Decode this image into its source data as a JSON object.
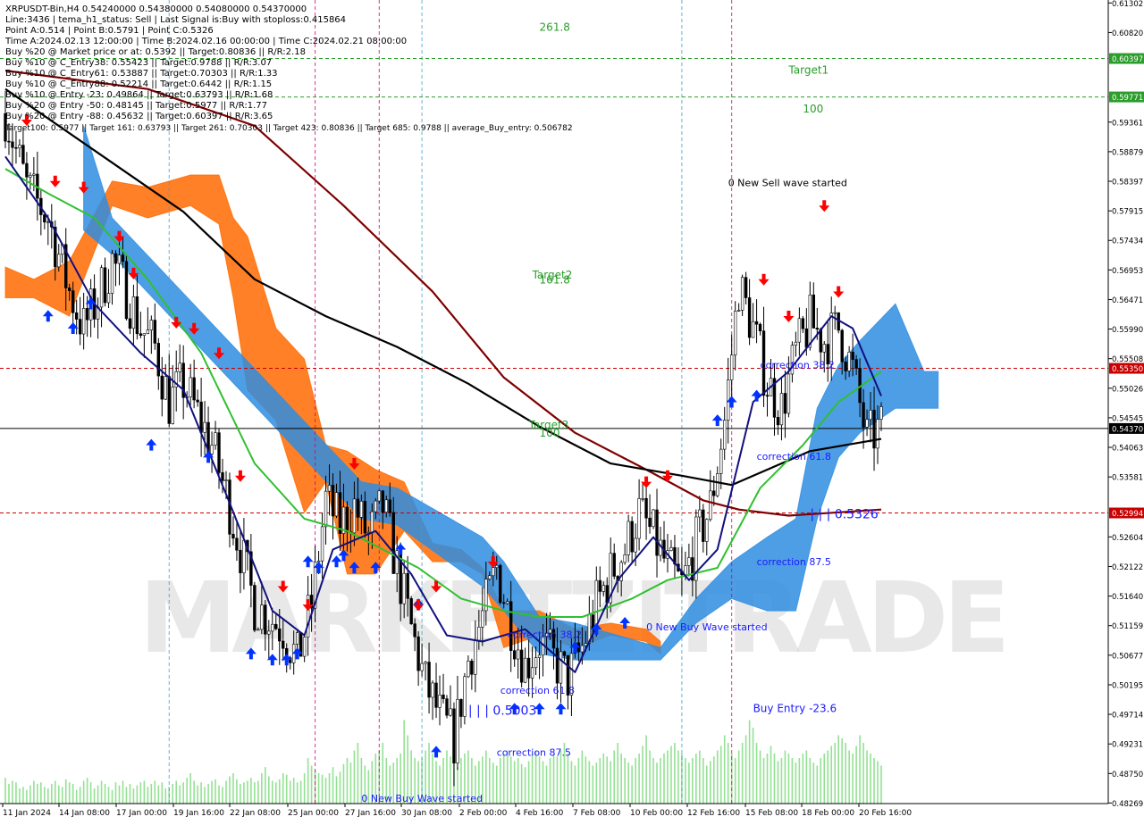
{
  "header": {
    "title": "XRPUSDT-Bin,H4  0.54240000 0.54380000 0.54080000 0.54370000",
    "lines": [
      "Line:3436 | tema_h1_status: Sell | Last Signal is:Buy with stoploss:0.415864",
      "Point A:0.514 | Point B:0.5791 | Point C:0.5326",
      "Time A:2024.02.13 12:00:00 | Time B:2024.02.16 00:00:00 | Time C:2024.02.21 08:00:00",
      "Buy %20 @ Market price or at: 0.5392 || Target:0.80836 || R/R:2.18",
      "Buy %10 @ C_Entry38: 0.55423 || Target:0.9788 || R/R:3.07",
      "Buy %10 @ C_Entry61: 0.53887 || Target:0.70303 || R/R:1.33",
      "Buy %10 @ C_Entry88: 0.52214 || Target:0.6442 || R/R:1.15",
      "Buy %10 @ Entry -23: 0.49864 || Target:0.63793 || R/R:1.68",
      "Buy %20 @ Entry -50: 0.48145 || Target:0.5977 || R/R:1.77",
      "Buy %20 @ Entry -88: 0.45632 || Target:0.60397 || R/R:3.65",
      "Target100: 0.5977 || Target 161: 0.63793 || Target 261: 0.70303 || Target 423: 0.80836 || Target 685: 0.9788 || average_Buy_entry: 0.506782"
    ]
  },
  "watermark": "MARKETZITRADE",
  "colors": {
    "bull": "#00c800",
    "bear": "#c80000",
    "ema_fast": "#10107f",
    "ema_mid": "#30c030",
    "ema_slow": "#000000",
    "ema_long": "#7f0000",
    "cloud_orange": "#ff6a00",
    "cloud_blue": "#2f8de0",
    "buy_arrow": "#0033ff",
    "sell_arrow": "#ff0000",
    "green_text": "#2a9d2a",
    "blue_text": "#1a1aff"
  },
  "chart_data": {
    "type": "candlestick",
    "symbol": "XRPUSDT-Bin",
    "timeframe": "H4",
    "ylim": [
      0.4826,
      0.6135
    ],
    "yticks": [
      0.61302,
      0.6082,
      0.60397,
      0.59771,
      0.59361,
      0.58879,
      0.58397,
      0.57915,
      0.57434,
      0.56953,
      0.5647,
      0.5599,
      0.55508,
      0.5535,
      0.55026,
      0.54545,
      0.5437,
      0.54063,
      0.53581,
      0.52994,
      0.52604,
      0.52122,
      0.5164,
      0.51159,
      0.50677,
      0.50195,
      0.49714,
      0.49231,
      0.4875,
      0.48269
    ],
    "yticks_text": [
      "0.61302",
      "0.60820",
      "0.60397",
      "0.59771",
      "0.59361",
      "0.58879",
      "0.58397",
      "0.57915",
      "0.57434",
      "0.56953",
      "0.56471",
      "0.55990",
      "0.55508",
      "0.55350",
      "0.55026",
      "0.54545",
      "0.54370",
      "0.54063",
      "0.53581",
      "0.52994",
      "0.52604",
      "0.52122",
      "0.51640",
      "0.51159",
      "0.50677",
      "0.50195",
      "0.49714",
      "0.49231",
      "0.48750",
      "0.48269"
    ],
    "highlighted_levels": [
      {
        "value": 0.60397,
        "label": "0.60397",
        "color": "#2a9d2a",
        "style": "dash"
      },
      {
        "value": 0.59771,
        "label": "0.59771",
        "color": "#2a9d2a",
        "style": "dash"
      },
      {
        "value": 0.5535,
        "label": "0.55350",
        "color": "#c80000",
        "style": "dash"
      },
      {
        "value": 0.5437,
        "label": "0.54370",
        "color": "#000000",
        "style": "solid"
      },
      {
        "value": 0.52994,
        "label": "0.52994",
        "color": "#c80000",
        "style": "dash"
      }
    ],
    "xticks": [
      "11 Jan 2024",
      "14 Jan 08:00",
      "17 Jan 00:00",
      "19 Jan 16:00",
      "22 Jan 08:00",
      "25 Jan 00:00",
      "27 Jan 16:00",
      "30 Jan 08:00",
      "2 Feb 00:00",
      "4 Feb 16:00",
      "7 Feb 08:00",
      "10 Feb 00:00",
      "12 Feb 16:00",
      "15 Feb 08:00",
      "18 Feb 00:00",
      "20 Feb 16:00"
    ],
    "close_path": [
      [
        0,
        0.595
      ],
      [
        6,
        0.583
      ],
      [
        12,
        0.578
      ],
      [
        18,
        0.566
      ],
      [
        22,
        0.56
      ],
      [
        26,
        0.565
      ],
      [
        30,
        0.571
      ],
      [
        34,
        0.566
      ],
      [
        38,
        0.56
      ],
      [
        42,
        0.557
      ],
      [
        46,
        0.548
      ],
      [
        50,
        0.551
      ],
      [
        54,
        0.546
      ],
      [
        58,
        0.541
      ],
      [
        62,
        0.533
      ],
      [
        66,
        0.524
      ],
      [
        70,
        0.515
      ],
      [
        74,
        0.513
      ],
      [
        78,
        0.511
      ],
      [
        82,
        0.506
      ],
      [
        86,
        0.515
      ],
      [
        90,
        0.532
      ],
      [
        94,
        0.528
      ],
      [
        98,
        0.531
      ],
      [
        102,
        0.526
      ],
      [
        106,
        0.531
      ],
      [
        110,
        0.521
      ],
      [
        114,
        0.511
      ],
      [
        118,
        0.502
      ],
      [
        122,
        0.497
      ],
      [
        126,
        0.493
      ],
      [
        130,
        0.506
      ],
      [
        134,
        0.513
      ],
      [
        138,
        0.521
      ],
      [
        142,
        0.512
      ],
      [
        146,
        0.505
      ],
      [
        150,
        0.509
      ],
      [
        154,
        0.506
      ],
      [
        158,
        0.503
      ],
      [
        162,
        0.508
      ],
      [
        166,
        0.515
      ],
      [
        170,
        0.52
      ],
      [
        174,
        0.524
      ],
      [
        178,
        0.53
      ],
      [
        182,
        0.526
      ],
      [
        186,
        0.521
      ],
      [
        190,
        0.518
      ],
      [
        194,
        0.525
      ],
      [
        198,
        0.531
      ],
      [
        202,
        0.545
      ],
      [
        206,
        0.567
      ],
      [
        210,
        0.56
      ],
      [
        214,
        0.551
      ],
      [
        218,
        0.547
      ],
      [
        222,
        0.556
      ],
      [
        226,
        0.561
      ],
      [
        230,
        0.558
      ],
      [
        234,
        0.56
      ],
      [
        238,
        0.553
      ],
      [
        242,
        0.542
      ],
      [
        246,
        0.5437
      ]
    ],
    "total_bars": 247,
    "ema_fast": [
      [
        0,
        0.588
      ],
      [
        12,
        0.578
      ],
      [
        25,
        0.564
      ],
      [
        38,
        0.556
      ],
      [
        50,
        0.55
      ],
      [
        62,
        0.533
      ],
      [
        75,
        0.514
      ],
      [
        84,
        0.51
      ],
      [
        92,
        0.524
      ],
      [
        104,
        0.527
      ],
      [
        114,
        0.52
      ],
      [
        124,
        0.51
      ],
      [
        134,
        0.509
      ],
      [
        146,
        0.511
      ],
      [
        160,
        0.504
      ],
      [
        172,
        0.519
      ],
      [
        182,
        0.526
      ],
      [
        192,
        0.519
      ],
      [
        200,
        0.524
      ],
      [
        210,
        0.548
      ],
      [
        220,
        0.553
      ],
      [
        232,
        0.562
      ],
      [
        238,
        0.56
      ],
      [
        246,
        0.549
      ]
    ],
    "ema_mid": [
      [
        0,
        0.586
      ],
      [
        12,
        0.582
      ],
      [
        25,
        0.578
      ],
      [
        40,
        0.568
      ],
      [
        55,
        0.556
      ],
      [
        70,
        0.538
      ],
      [
        84,
        0.529
      ],
      [
        96,
        0.527
      ],
      [
        106,
        0.524
      ],
      [
        116,
        0.521
      ],
      [
        128,
        0.516
      ],
      [
        140,
        0.514
      ],
      [
        150,
        0.513
      ],
      [
        162,
        0.513
      ],
      [
        176,
        0.516
      ],
      [
        186,
        0.519
      ],
      [
        200,
        0.521
      ],
      [
        212,
        0.534
      ],
      [
        224,
        0.541
      ],
      [
        234,
        0.548
      ],
      [
        246,
        0.553
      ]
    ],
    "ema_slow": [
      [
        0,
        0.599
      ],
      [
        30,
        0.587
      ],
      [
        50,
        0.579
      ],
      [
        70,
        0.568
      ],
      [
        90,
        0.562
      ],
      [
        110,
        0.557
      ],
      [
        130,
        0.551
      ],
      [
        150,
        0.544
      ],
      [
        170,
        0.538
      ],
      [
        190,
        0.536
      ],
      [
        204,
        0.5345
      ],
      [
        214,
        0.537
      ],
      [
        226,
        0.54
      ],
      [
        246,
        0.542
      ]
    ],
    "ema_long": [
      [
        0,
        0.602
      ],
      [
        40,
        0.599
      ],
      [
        70,
        0.593
      ],
      [
        95,
        0.58
      ],
      [
        120,
        0.566
      ],
      [
        140,
        0.552
      ],
      [
        160,
        0.543
      ],
      [
        180,
        0.537
      ],
      [
        196,
        0.532
      ],
      [
        206,
        0.5305
      ],
      [
        220,
        0.5295
      ],
      [
        246,
        0.5305
      ]
    ],
    "cloud_orange": [
      [
        0,
        0.57,
        0.565
      ],
      [
        8,
        0.568,
        0.565
      ],
      [
        18,
        0.562,
        0.571
      ],
      [
        30,
        0.584,
        0.58
      ],
      [
        40,
        0.583,
        0.578
      ],
      [
        52,
        0.585,
        0.58
      ],
      [
        60,
        0.585,
        0.577
      ],
      [
        64,
        0.578,
        0.565
      ],
      [
        68,
        0.575,
        0.55
      ],
      [
        76,
        0.56,
        0.545
      ],
      [
        84,
        0.555,
        0.53
      ],
      [
        90,
        0.541,
        0.535
      ],
      [
        96,
        0.54,
        0.52
      ],
      [
        104,
        0.537,
        0.52
      ],
      [
        112,
        0.535,
        0.527
      ],
      [
        120,
        0.525,
        0.522
      ],
      [
        128,
        0.524,
        0.522
      ],
      [
        134,
        0.521,
        0.52
      ],
      [
        140,
        0.514,
        0.508
      ],
      [
        150,
        0.514,
        0.51
      ],
      [
        160,
        0.511,
        0.508
      ],
      [
        170,
        0.512,
        0.51
      ],
      [
        180,
        0.511,
        0.509
      ],
      [
        184,
        0.509,
        0.507
      ]
    ],
    "cloud_blue": [
      [
        22,
        0.593,
        0.576
      ],
      [
        30,
        0.578,
        0.572
      ],
      [
        100,
        0.535,
        0.529
      ],
      [
        110,
        0.534,
        0.528
      ],
      [
        134,
        0.526,
        0.518
      ],
      [
        140,
        0.522,
        0.514
      ],
      [
        150,
        0.513,
        0.507
      ],
      [
        160,
        0.512,
        0.506
      ],
      [
        184,
        0.508,
        0.506
      ],
      [
        194,
        0.516,
        0.512
      ],
      [
        204,
        0.522,
        0.516
      ],
      [
        214,
        0.526,
        0.514
      ],
      [
        222,
        0.529,
        0.514
      ],
      [
        228,
        0.547,
        0.529
      ],
      [
        234,
        0.554,
        0.539
      ],
      [
        240,
        0.558,
        0.543
      ],
      [
        250,
        0.564,
        0.547
      ],
      [
        258,
        0.553,
        0.547
      ],
      [
        262,
        0.553,
        0.547
      ]
    ],
    "fib_lines": [
      {
        "x": 87,
        "color": "#cc0077"
      },
      {
        "x": 105,
        "color": "#cc0077"
      },
      {
        "x": 204,
        "color": "#cc0077"
      },
      {
        "x": 46,
        "color": "#3aa0d0"
      },
      {
        "x": 117,
        "color": "#3aa0d0"
      },
      {
        "x": 190,
        "color": "#3aa0d0"
      }
    ],
    "annotations": [
      {
        "text": "261.8",
        "x": 150,
        "y": 0.6085,
        "color": "#2a9d2a",
        "size": 12
      },
      {
        "text": "Target1",
        "x": 220,
        "y": 0.6015,
        "color": "#2a9d2a",
        "size": 12
      },
      {
        "text": "100",
        "x": 224,
        "y": 0.5952,
        "color": "#2a9d2a",
        "size": 12
      },
      {
        "text": "Target2",
        "x": 148,
        "y": 0.5681,
        "color": "#2a9d2a",
        "size": 12
      },
      {
        "text": "161.8",
        "x": 150,
        "y": 0.5673,
        "color": "#2a9d2a",
        "size": 12
      },
      {
        "text": "Target3",
        "x": 147,
        "y": 0.5437,
        "color": "#2a9d2a",
        "size": 12
      },
      {
        "text": "100",
        "x": 150,
        "y": 0.5424,
        "color": "#2a9d2a",
        "size": 12
      },
      {
        "text": "0 New Sell wave started",
        "x": 203,
        "y": 0.5832,
        "color": "#000000",
        "size": 11
      },
      {
        "text": "correction 38.2",
        "x": 212,
        "y": 0.5535,
        "color": "#1a1aff",
        "size": 11
      },
      {
        "text": "correction 61.8",
        "x": 211,
        "y": 0.5386,
        "color": "#1a1aff",
        "size": 11
      },
      {
        "text": "| | | 0.5326",
        "x": 226,
        "y": 0.5291,
        "color": "#1a1aff",
        "size": 14
      },
      {
        "text": "correction 87.5",
        "x": 211,
        "y": 0.5214,
        "color": "#1a1aff",
        "size": 11
      },
      {
        "text": "0 New Buy Wave started",
        "x": 180,
        "y": 0.5108,
        "color": "#1a1aff",
        "size": 11
      },
      {
        "text": "Buy Entry -23.6",
        "x": 210,
        "y": 0.4975,
        "color": "#1a1aff",
        "size": 12
      },
      {
        "text": "correction 38.2",
        "x": 141,
        "y": 0.5096,
        "color": "#1a1aff",
        "size": 11
      },
      {
        "text": "correction 61.8",
        "x": 139,
        "y": 0.5005,
        "color": "#1a1aff",
        "size": 11
      },
      {
        "text": "| | | 0.5003",
        "x": 130,
        "y": 0.4971,
        "color": "#1a1aff",
        "size": 14
      },
      {
        "text": "correction 87.5",
        "x": 138,
        "y": 0.4904,
        "color": "#1a1aff",
        "size": 11
      },
      {
        "text": "0 New Buy Wave started",
        "x": 100,
        "y": 0.4829,
        "color": "#1a1aff",
        "size": 11
      }
    ],
    "buy_arrows": [
      [
        12,
        0.563
      ],
      [
        19,
        0.561
      ],
      [
        24,
        0.565
      ],
      [
        41,
        0.542
      ],
      [
        57,
        0.54
      ],
      [
        69,
        0.508
      ],
      [
        75,
        0.507
      ],
      [
        79,
        0.507
      ],
      [
        82,
        0.508
      ],
      [
        85,
        0.523
      ],
      [
        88,
        0.522
      ],
      [
        93,
        0.523
      ],
      [
        98,
        0.522
      ],
      [
        95,
        0.524
      ],
      [
        104,
        0.522
      ],
      [
        111,
        0.525
      ],
      [
        116,
        0.516
      ],
      [
        121,
        0.492
      ],
      [
        143,
        0.499
      ],
      [
        150,
        0.499
      ],
      [
        156,
        0.499
      ],
      [
        160,
        0.509
      ],
      [
        166,
        0.512
      ],
      [
        174,
        0.513
      ],
      [
        200,
        0.546
      ],
      [
        204,
        0.549
      ],
      [
        211,
        0.55
      ]
    ],
    "sell_arrows": [
      [
        6,
        0.593
      ],
      [
        14,
        0.583
      ],
      [
        22,
        0.582
      ],
      [
        32,
        0.574
      ],
      [
        36,
        0.568
      ],
      [
        48,
        0.56
      ],
      [
        53,
        0.559
      ],
      [
        60,
        0.555
      ],
      [
        66,
        0.535
      ],
      [
        78,
        0.517
      ],
      [
        85,
        0.514
      ],
      [
        98,
        0.537
      ],
      [
        121,
        0.517
      ],
      [
        137,
        0.521
      ],
      [
        116,
        0.514
      ],
      [
        186,
        0.535
      ],
      [
        180,
        0.534
      ],
      [
        213,
        0.567
      ],
      [
        220,
        0.561
      ],
      [
        230,
        0.579
      ],
      [
        234,
        0.565
      ]
    ],
    "volume": [
      34,
      26,
      30,
      28,
      20,
      22,
      18,
      24,
      30,
      26,
      28,
      22,
      20,
      26,
      30,
      24,
      22,
      32,
      28,
      26,
      18,
      22,
      30,
      34,
      28,
      20,
      24,
      30,
      26,
      22,
      18,
      28,
      24,
      30,
      22,
      26,
      20,
      24,
      28,
      30,
      22,
      26,
      30,
      24,
      28,
      20,
      22,
      26,
      30,
      24,
      28,
      34,
      40,
      30,
      24,
      28,
      22,
      26,
      30,
      32,
      24,
      22,
      30,
      36,
      40,
      32,
      26,
      28,
      30,
      34,
      28,
      30,
      40,
      48,
      36,
      30,
      28,
      32,
      40,
      38,
      30,
      34,
      28,
      30,
      40,
      60,
      50,
      44,
      40,
      38,
      34,
      40,
      48,
      36,
      42,
      52,
      60,
      54,
      70,
      80,
      60,
      50,
      44,
      56,
      66,
      70,
      80,
      60,
      50,
      54,
      60,
      66,
      110,
      90,
      70,
      60,
      56,
      60,
      70,
      80,
      66,
      56,
      50,
      60,
      70,
      62,
      54,
      48,
      60,
      66,
      70,
      60,
      50,
      56,
      62,
      70,
      60,
      54,
      50,
      60,
      66,
      70,
      62,
      56,
      60,
      52,
      48,
      56,
      66,
      70,
      62,
      56,
      50,
      60,
      66,
      62,
      70,
      80,
      66,
      56,
      50,
      60,
      70,
      62,
      56,
      50,
      54,
      60,
      66,
      62,
      56,
      70,
      80,
      66,
      60,
      54,
      50,
      60,
      66,
      76,
      90,
      70,
      60,
      54,
      60,
      66,
      70,
      76,
      80,
      70,
      66,
      60,
      54,
      60,
      66,
      70,
      60,
      50,
      56,
      62,
      70,
      76,
      90,
      80,
      66,
      60,
      70,
      80,
      90,
      110,
      100,
      80,
      70,
      60,
      66,
      76,
      66,
      56,
      60,
      70,
      66,
      60,
      54,
      60,
      66,
      70,
      60,
      54,
      50,
      60,
      66,
      70,
      76,
      80,
      90,
      86,
      80,
      70,
      66,
      76,
      90,
      80,
      70,
      66,
      60,
      56,
      50
    ]
  }
}
